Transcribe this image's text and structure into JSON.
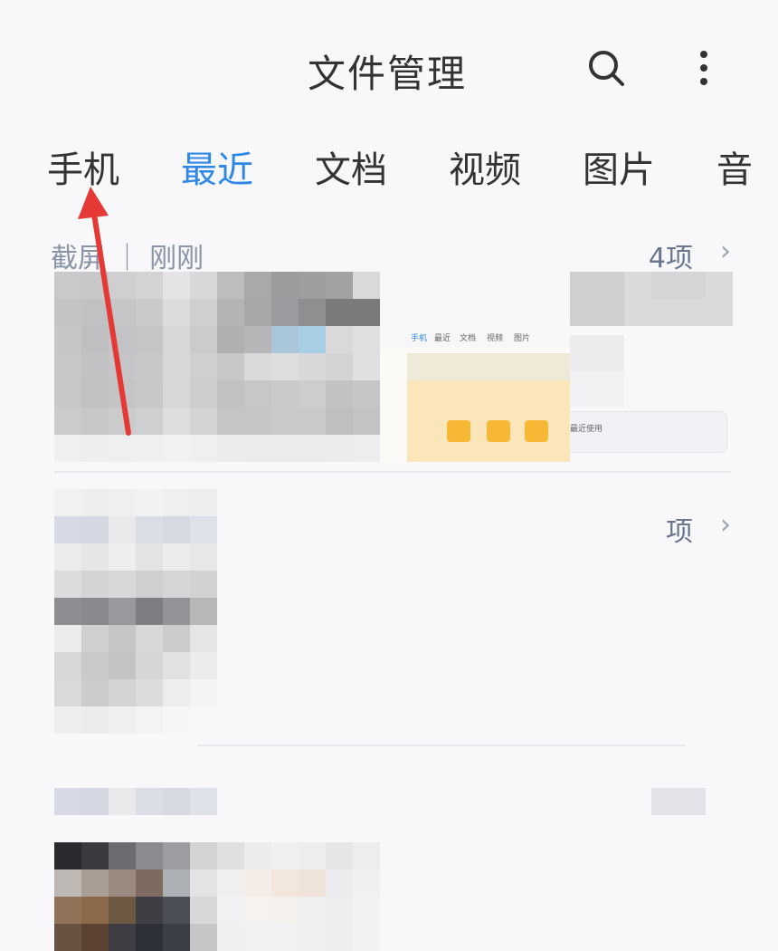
{
  "header": {
    "title": "文件管理",
    "search_icon": "search-icon",
    "more_icon": "more-vertical-icon"
  },
  "tabs": [
    {
      "label": "手机",
      "active": false
    },
    {
      "label": "最近",
      "active": true
    },
    {
      "label": "文档",
      "active": false
    },
    {
      "label": "视频",
      "active": false
    },
    {
      "label": "图片",
      "active": false
    },
    {
      "label": "音",
      "active": false
    }
  ],
  "sections": [
    {
      "label": "截屏 ｜ 刚刚",
      "count": "4项"
    },
    {
      "label": "",
      "count": "项"
    }
  ],
  "thumbnail_texts": {
    "mini_tabs": [
      "手机",
      "最近",
      "文档",
      "视频",
      "图片"
    ],
    "mini_card": "最近使用"
  },
  "colors": {
    "accent": "#2f87e6",
    "annotation": "#e53935",
    "text_primary": "#333333",
    "text_secondary": "#8a93a8"
  }
}
